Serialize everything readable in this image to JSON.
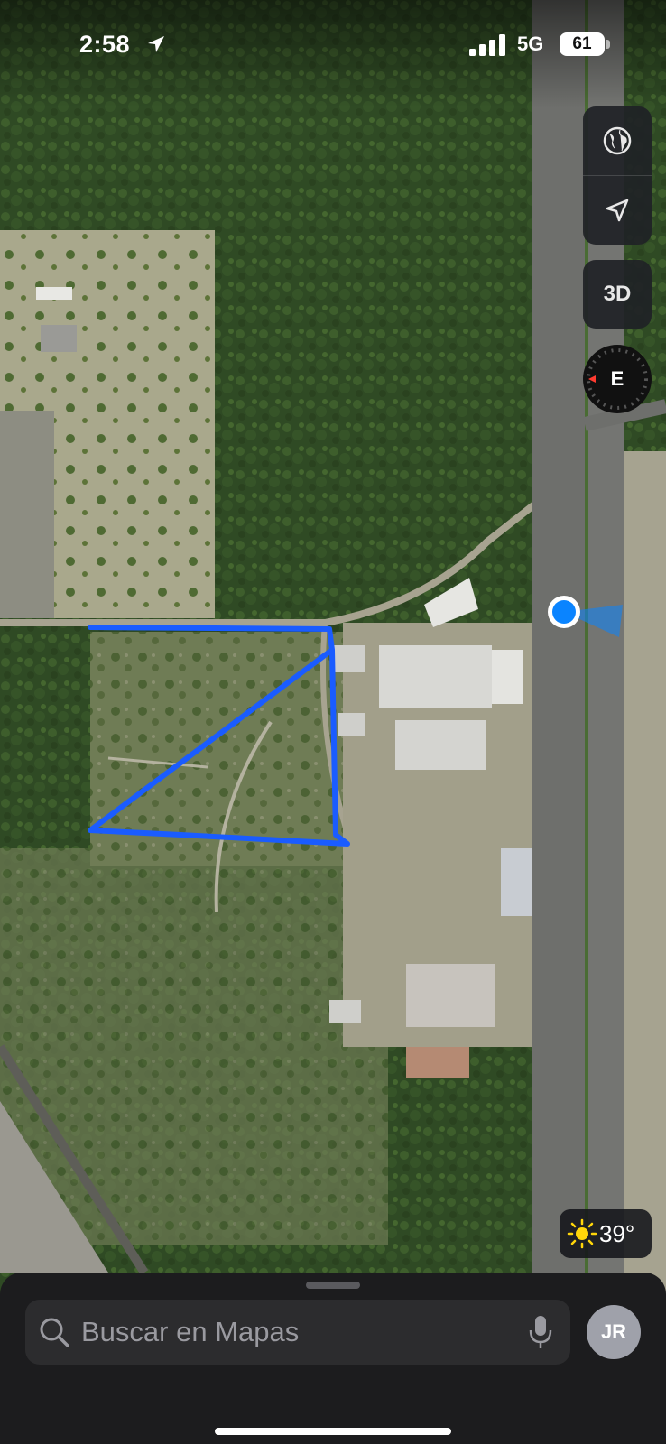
{
  "status_bar": {
    "time": "2:58",
    "network": "5G",
    "battery": "61"
  },
  "map_controls": {
    "map_mode_icon": "globe-icon",
    "location_icon": "location-arrow-icon",
    "view_3d_label": "3D",
    "compass_label": "E"
  },
  "weather": {
    "icon": "sun-icon",
    "temperature": "39°"
  },
  "search": {
    "placeholder": "Buscar en Mapas"
  },
  "profile": {
    "initials": "JR"
  },
  "colors": {
    "route": "#1a5cff",
    "user_location": "#0a84ff",
    "sheet_background": "#1c1c1e"
  }
}
